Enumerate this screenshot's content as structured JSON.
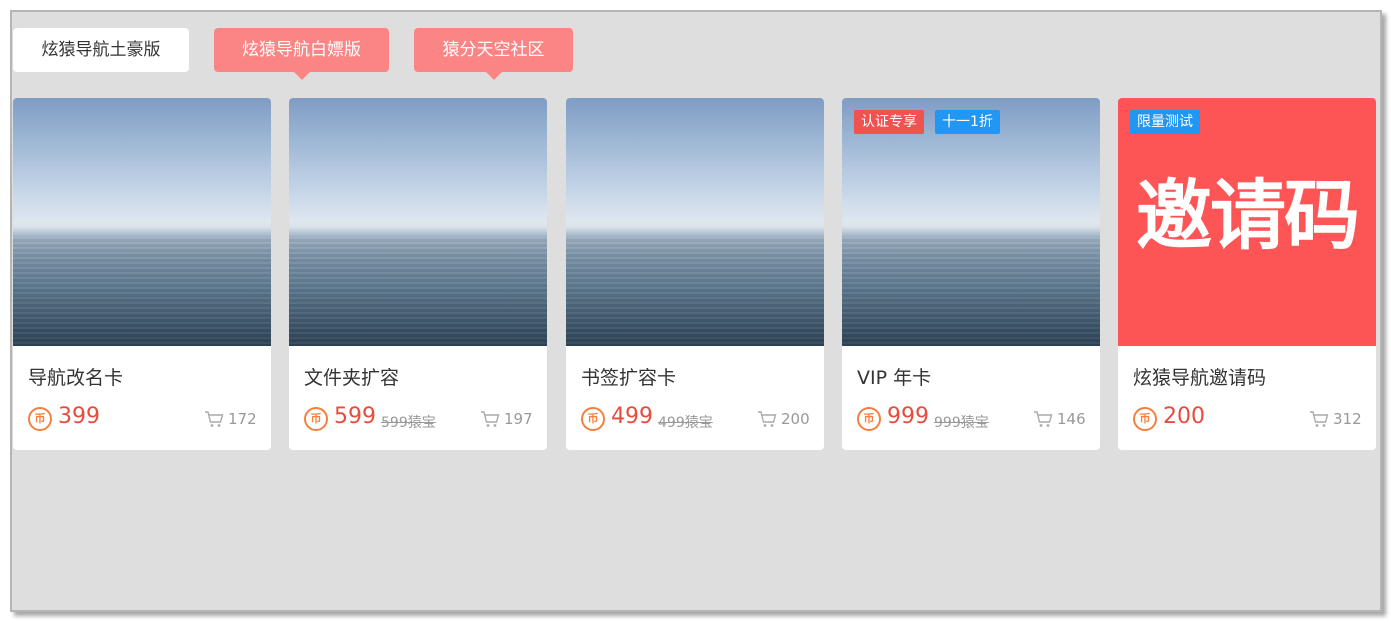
{
  "tabs": [
    {
      "label": "炫猿导航土豪版"
    },
    {
      "label": "炫猿导航白嫖版"
    },
    {
      "label": "猿分天空社区"
    }
  ],
  "coin_glyph": "币",
  "cards": [
    {
      "title": "导航改名卡",
      "price": "399",
      "original_price": "",
      "sales": "172",
      "image": "ocean-horizon"
    },
    {
      "title": "文件夹扩容",
      "price": "599",
      "original_price": "599猿宝",
      "sales": "197",
      "image": "ocean-horizon"
    },
    {
      "title": "书签扩容卡",
      "price": "499",
      "original_price": "499猿宝",
      "sales": "200",
      "image": "ocean-horizon"
    },
    {
      "title": "VIP 年卡",
      "price": "999",
      "original_price": "999猿宝",
      "sales": "146",
      "image": "ocean-horizon",
      "badges": [
        "认证专享",
        "十一1折"
      ]
    },
    {
      "title": "炫猿导航邀请码",
      "price": "200",
      "original_price": "",
      "sales": "312",
      "image_text": "邀请码",
      "badges": [
        "限量测试"
      ]
    }
  ],
  "colors": {
    "accent_pink": "#fb8585",
    "price_red": "#e84c3d",
    "coin_orange": "#f5803e",
    "badge_red": "#ef5350",
    "badge_blue": "#2196f3",
    "invite_bg": "#fd5555"
  }
}
